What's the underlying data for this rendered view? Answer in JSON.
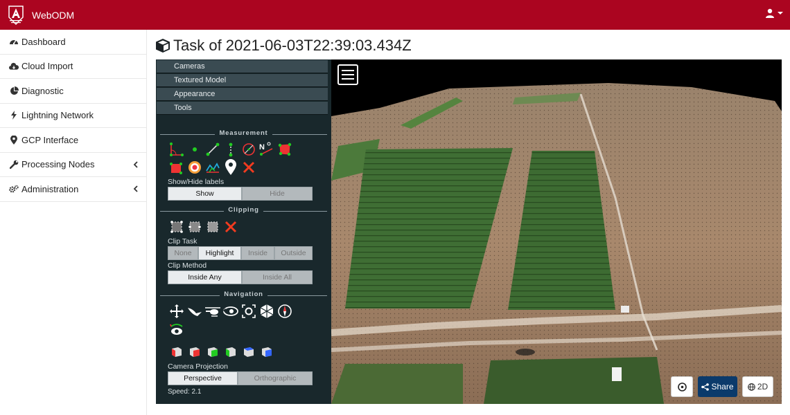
{
  "app": {
    "name": "WebODM"
  },
  "sidebar": {
    "items": [
      {
        "label": "Dashboard",
        "icon": "dashboard-icon"
      },
      {
        "label": "Cloud Import",
        "icon": "cloud-download-icon"
      },
      {
        "label": "Diagnostic",
        "icon": "pie-chart-icon"
      },
      {
        "label": "Lightning Network",
        "icon": "bolt-icon"
      },
      {
        "label": "GCP Interface",
        "icon": "map-marker-icon"
      },
      {
        "label": "Processing Nodes",
        "icon": "wrench-icon"
      },
      {
        "label": "Administration",
        "icon": "cogs-icon"
      }
    ]
  },
  "page": {
    "title": "Task of 2021-06-03T22:39:03.434Z"
  },
  "panel": {
    "accordion": [
      "Cameras",
      "Textured Model",
      "Appearance",
      "Tools"
    ],
    "measurement": {
      "heading": "Measurement",
      "labels_caption": "Show/Hide labels",
      "show": "Show",
      "hide": "Hide",
      "compass_letter": "N"
    },
    "clipping": {
      "heading": "Clipping",
      "task_caption": "Clip Task",
      "task_options": [
        "None",
        "Highlight",
        "Inside",
        "Outside"
      ],
      "task_selected": "Highlight",
      "method_caption": "Clip Method",
      "method_options": [
        "Inside Any",
        "Inside All"
      ]
    },
    "navigation": {
      "heading": "Navigation",
      "projection_caption": "Camera Projection",
      "perspective": "Perspective",
      "orthographic": "Orthographic",
      "speed_text": "Speed: 2.1"
    }
  },
  "viewer_buttons": {
    "share": "Share",
    "twod": "2D"
  },
  "colors": {
    "brand": "#ab0520",
    "panel": "#19282c",
    "share": "#0b3a6b"
  }
}
